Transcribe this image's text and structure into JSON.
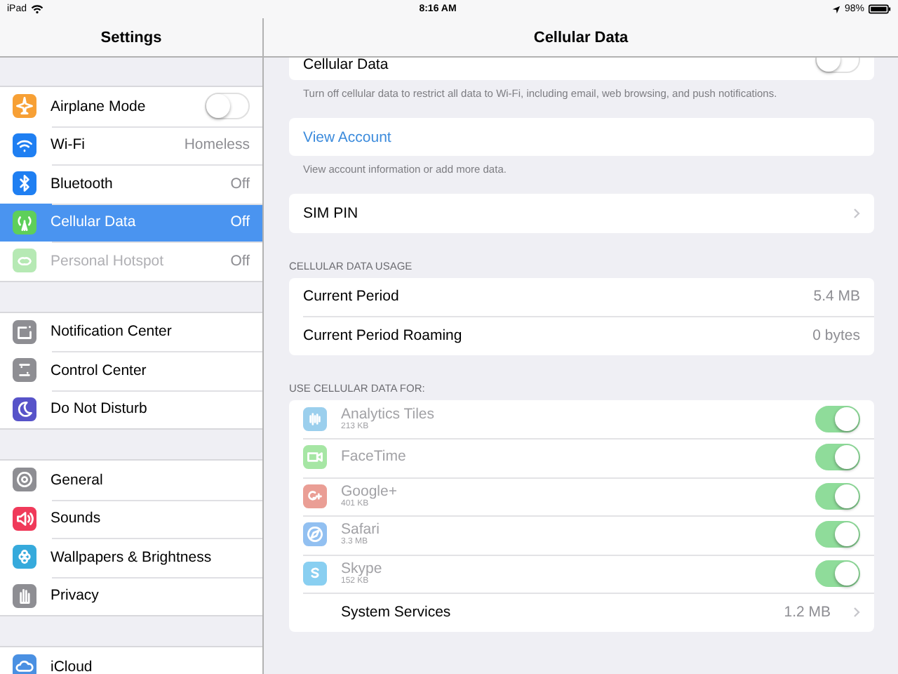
{
  "status_bar": {
    "device": "iPad",
    "time": "8:16 AM",
    "battery": "98%"
  },
  "sidebar": {
    "title": "Settings",
    "groups": [
      {
        "items": [
          {
            "label": "Airplane Mode",
            "kind": "toggle",
            "on": false,
            "selected": false,
            "disabled": false
          },
          {
            "label": "Wi-Fi",
            "kind": "value",
            "value": "Homeless",
            "selected": false,
            "disabled": false
          },
          {
            "label": "Bluetooth",
            "kind": "value",
            "value": "Off",
            "selected": false,
            "disabled": false
          },
          {
            "label": "Cellular Data",
            "kind": "value",
            "value": "Off",
            "selected": true,
            "disabled": false
          },
          {
            "label": "Personal Hotspot",
            "kind": "value",
            "value": "Off",
            "selected": false,
            "disabled": true
          }
        ]
      },
      {
        "items": [
          {
            "label": "Notification Center",
            "kind": "plain",
            "selected": false,
            "disabled": false
          },
          {
            "label": "Control Center",
            "kind": "plain",
            "selected": false,
            "disabled": false
          },
          {
            "label": "Do Not Disturb",
            "kind": "plain",
            "selected": false,
            "disabled": false
          }
        ]
      },
      {
        "items": [
          {
            "label": "General",
            "kind": "plain",
            "selected": false,
            "disabled": false
          },
          {
            "label": "Sounds",
            "kind": "plain",
            "selected": false,
            "disabled": false
          },
          {
            "label": "Wallpapers & Brightness",
            "kind": "plain",
            "selected": false,
            "disabled": false
          },
          {
            "label": "Privacy",
            "kind": "plain",
            "selected": false,
            "disabled": false
          }
        ]
      },
      {
        "items": [
          {
            "label": "iCloud",
            "kind": "plain",
            "selected": false,
            "disabled": false
          }
        ]
      }
    ]
  },
  "detail": {
    "title": "Cellular Data",
    "cellular_toggle": {
      "label": "Cellular Data",
      "on": false
    },
    "cellular_note": "Turn off cellular data to restrict all data to Wi-Fi, including email, web browsing, and push notifications.",
    "view_account": "View Account",
    "account_note": "View account information or add more data.",
    "sim_pin": "SIM PIN",
    "usage_header": "CELLULAR DATA USAGE",
    "usage": [
      {
        "label": "Current Period",
        "value": "5.4 MB"
      },
      {
        "label": "Current Period Roaming",
        "value": "0 bytes"
      }
    ],
    "apps_header": "USE CELLULAR DATA FOR:",
    "apps": [
      {
        "name": "Analytics Tiles",
        "size": "213 KB",
        "on": true,
        "disabled": true
      },
      {
        "name": "FaceTime",
        "on": true,
        "disabled": true
      },
      {
        "name": "Google+",
        "size": "401 KB",
        "on": true,
        "disabled": true
      },
      {
        "name": "Safari",
        "size": "3.3 MB",
        "on": true,
        "disabled": true
      },
      {
        "name": "Skype",
        "size": "152 KB",
        "on": true,
        "disabled": true
      }
    ],
    "system_services": {
      "label": "System Services",
      "value": "1.2 MB"
    }
  }
}
